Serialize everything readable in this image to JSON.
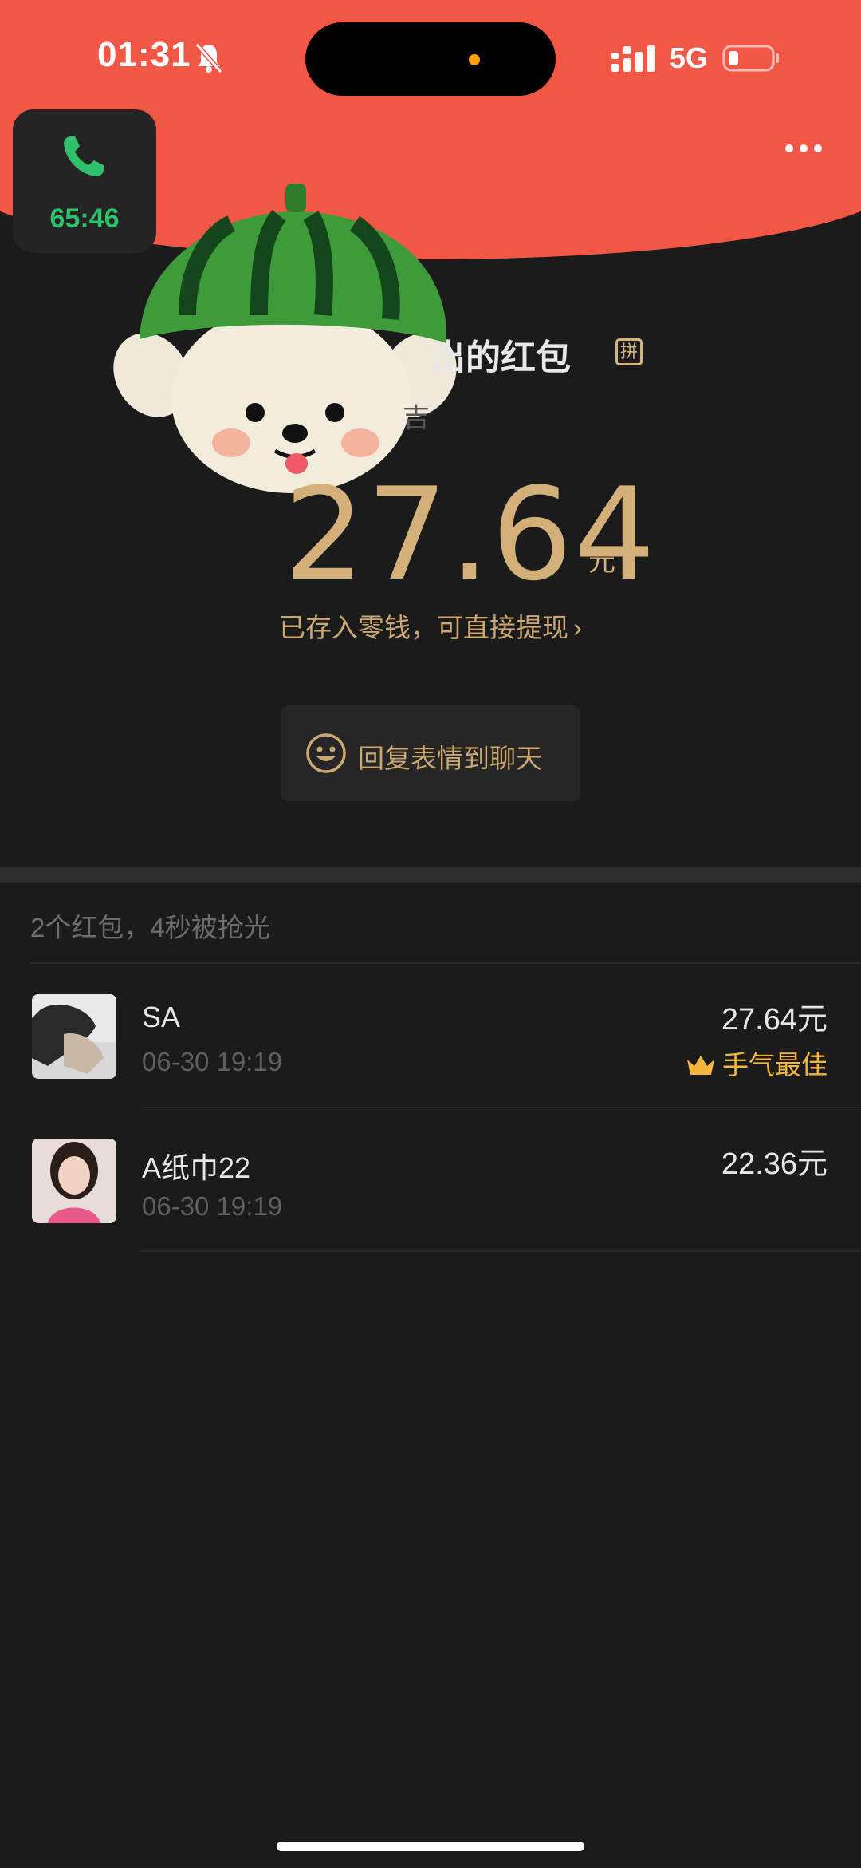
{
  "status_bar": {
    "time": "01:31",
    "network": "5G"
  },
  "call_widget": {
    "duration": "65:46"
  },
  "red_packet": {
    "title": "出的红包",
    "badge": "拼",
    "blessing": "吉",
    "amount": "27.64",
    "unit": "元",
    "wallet_link": "已存入零钱，可直接提现"
  },
  "reply_button": {
    "label": "回复表情到聊天"
  },
  "summary": "2个红包，4秒被抢光",
  "records": [
    {
      "name": "SA",
      "time": "06-30 19:19",
      "amount": "27.64元",
      "best": "手气最佳"
    },
    {
      "name": "A纸巾22",
      "time": "06-30 19:19",
      "amount": "22.36元"
    }
  ],
  "colors": {
    "header_red": "#f25745",
    "gold": "#d3b07a",
    "call_green": "#2fc06b",
    "best_orange": "#f5b73b",
    "background": "#1b1b1b"
  },
  "icons": [
    "bell-slash-icon",
    "signal-icon",
    "battery-icon",
    "phone-icon",
    "more-icon",
    "smile-icon",
    "crown-icon",
    "chevron-right-icon"
  ]
}
